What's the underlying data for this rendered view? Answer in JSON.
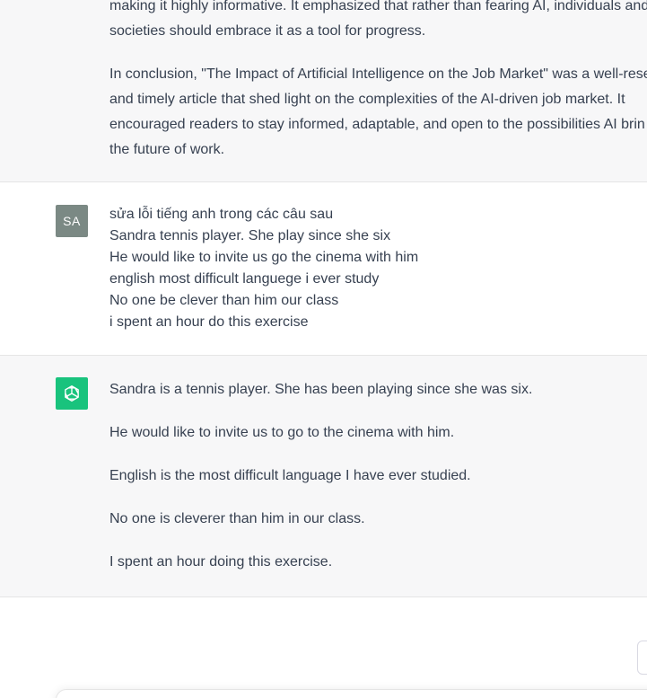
{
  "previous_response": {
    "paragraphs": [
      "making it highly informative. It emphasized that rather than fearing AI, individuals and\nsocieties should embrace it as a tool for progress.",
      "In conclusion, \"The Impact of Artificial Intelligence on the Job Market\" was a well-rese\nand timely article that shed light on the complexities of the AI-driven job market. It\nencouraged readers to stay informed, adaptable, and open to the possibilities AI brin\nthe future of work."
    ]
  },
  "user_message": {
    "avatar_initials": "SA",
    "lines": [
      "sửa lỗi tiếng anh trong các câu sau",
      "Sandra tennis player. She play since she six",
      "He would like to invite us go the cinema with him",
      "english most difficult languege i ever study",
      "No one be clever than him our class",
      "i spent an hour do this exercise"
    ]
  },
  "assistant_message": {
    "avatar_icon": "openai-logo-icon",
    "paragraphs": [
      "Sandra is a tennis player. She has been playing since she was six.",
      "He would like to invite us to go to the cinema with him.",
      "English is the most difficult language I have ever studied.",
      "No one is cleverer than him in our class.",
      "I spent an hour doing this exercise."
    ]
  },
  "colors": {
    "assistant_bg": "#f7f7f8",
    "user_avatar_bg": "#7b8984",
    "assistant_avatar_bg": "#19c37d",
    "text": "#374151"
  }
}
